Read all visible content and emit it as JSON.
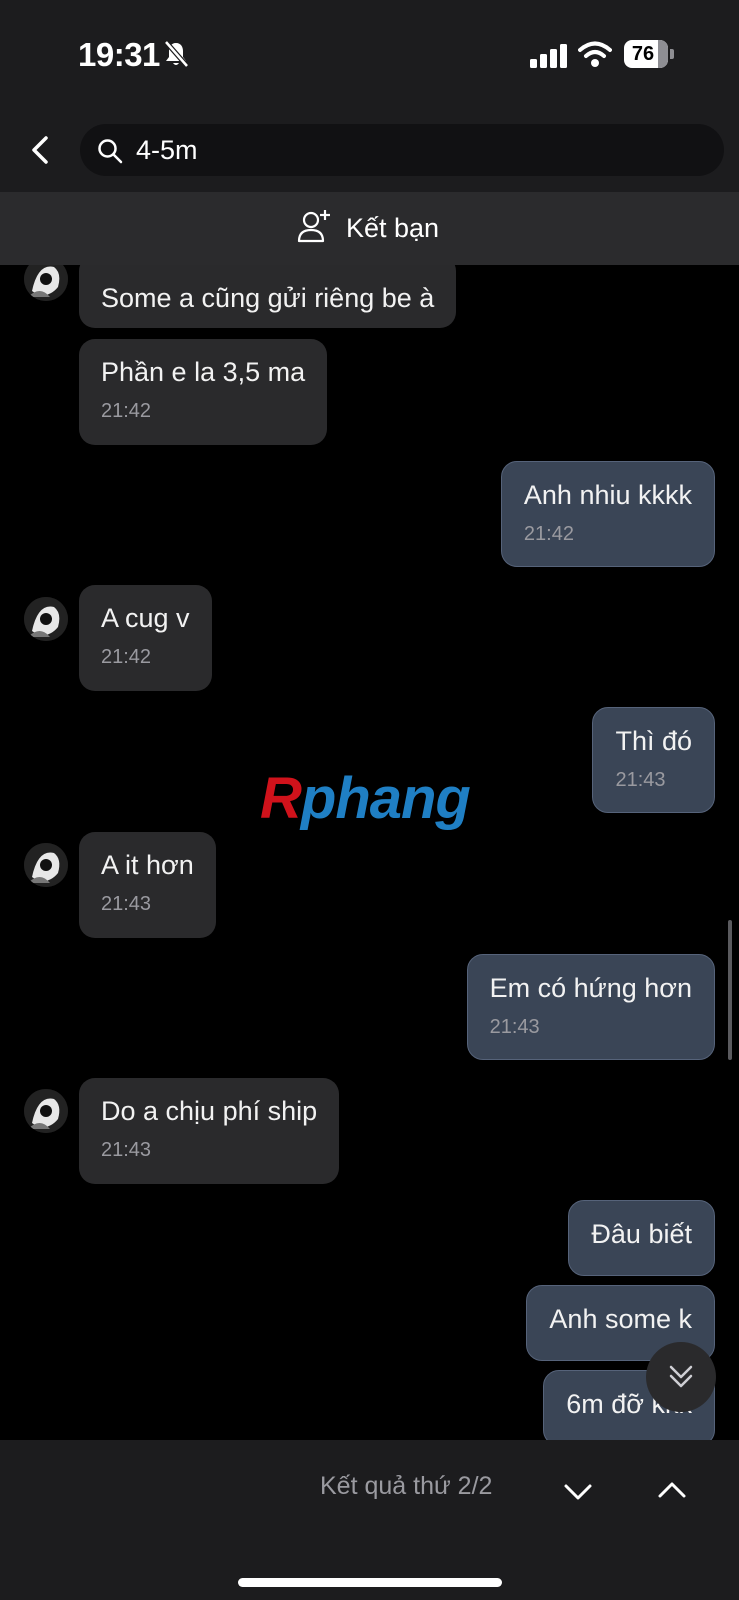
{
  "status_bar": {
    "time": "19:31",
    "battery": "76",
    "icons": [
      "bell-slash-icon",
      "signal-icon",
      "wifi-icon",
      "battery-icon"
    ]
  },
  "header": {
    "back_icon": "chevron-left-icon",
    "search_icon": "search-icon",
    "search_query": "4-5m"
  },
  "friend_bar": {
    "icon": "add-person-icon",
    "label": "Kết bạn"
  },
  "messages": [
    {
      "side": "in",
      "text": "Some a cũng gửi riêng be à",
      "time": ""
    },
    {
      "side": "in",
      "text": "Phần e la 3,5 ma",
      "time": "21:42"
    },
    {
      "side": "out",
      "text": "Anh nhiu kkkk",
      "time": "21:42"
    },
    {
      "side": "in",
      "text": "A cug v",
      "time": "21:42"
    },
    {
      "side": "out",
      "text": "Thì đó",
      "time": "21:43"
    },
    {
      "side": "in",
      "text": "A it hơn",
      "time": "21:43"
    },
    {
      "side": "out",
      "text": "Em có hứng hơn",
      "time": "21:43"
    },
    {
      "side": "in",
      "text": "Do a chịu phí ship",
      "time": "21:43"
    },
    {
      "side": "out",
      "text": "Đâu biết",
      "time": ""
    },
    {
      "side": "out",
      "text": "Anh some k",
      "time": ""
    },
    {
      "side": "out",
      "text": "6m đỡ kkk",
      "time": ""
    }
  ],
  "watermark": {
    "text_part1": "R",
    "text_part2": "phang",
    "color1": "#d0121b",
    "color2": "#1f7fc4"
  },
  "scroll_down_icon": "double-chevron-down-icon",
  "bottom_bar": {
    "result_text": "Kết quả thứ 2/2",
    "down_icon": "chevron-down-icon",
    "up_icon": "chevron-up-icon"
  },
  "colors": {
    "background": "#000000",
    "bar": "#1c1c1e",
    "incoming_bubble": "#2a2a2c",
    "outgoing_bubble": "#3a4556"
  }
}
